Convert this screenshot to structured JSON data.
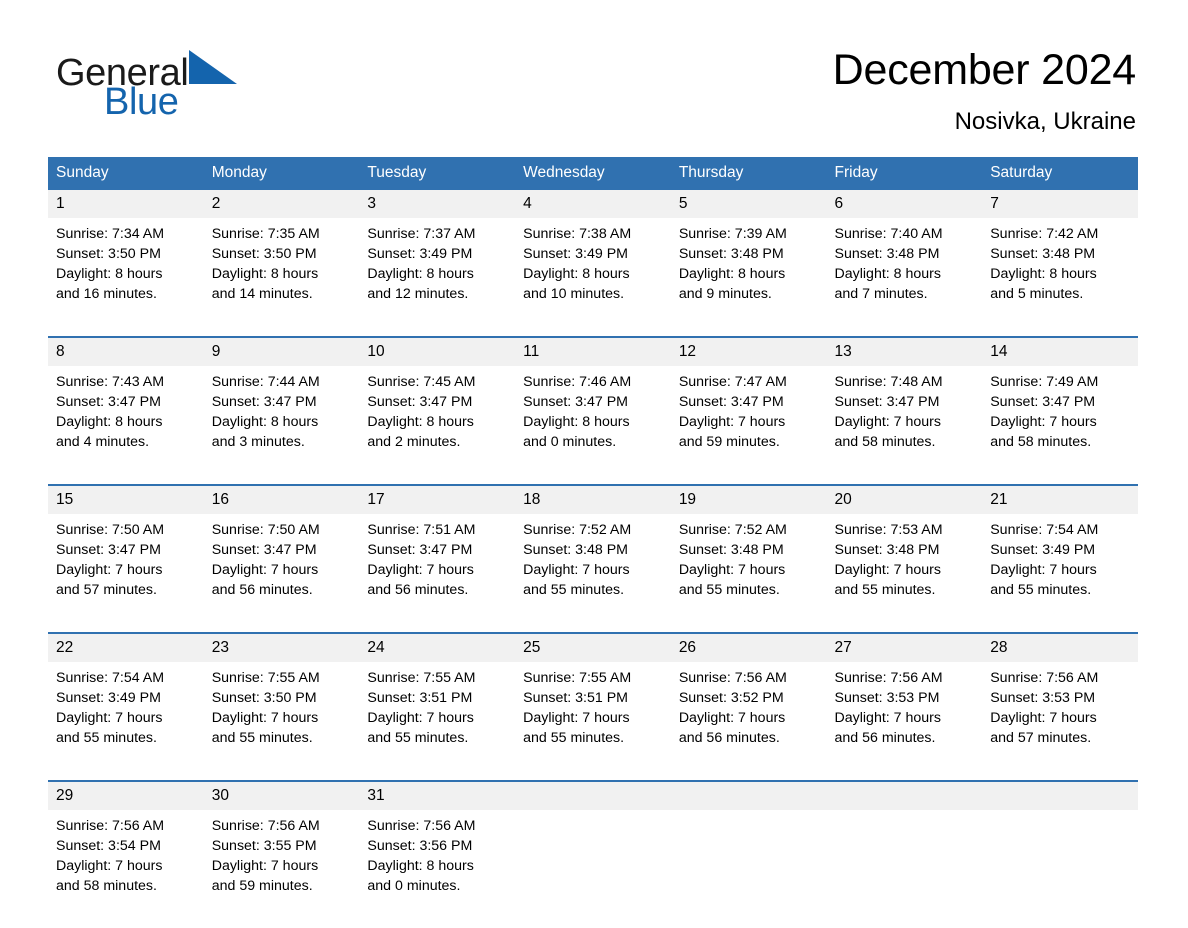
{
  "brand": {
    "name_part1": "General",
    "name_part2": "Blue",
    "triangle_color": "#1464ad",
    "text_color": "#1a1a1a"
  },
  "header": {
    "title": "December 2024",
    "location": "Nosivka, Ukraine"
  },
  "colors": {
    "header_blue": "#3071b0",
    "row_divider_blue": "#3071b0",
    "daynum_band": "#f1f1f1",
    "text": "#000000"
  },
  "weekday_headers": [
    "Sunday",
    "Monday",
    "Tuesday",
    "Wednesday",
    "Thursday",
    "Friday",
    "Saturday"
  ],
  "weeks": [
    {
      "days": [
        {
          "date": "1",
          "sunrise": "Sunrise: 7:34 AM",
          "sunset": "Sunset: 3:50 PM",
          "daylight_1": "Daylight: 8 hours",
          "daylight_2": "and 16 minutes."
        },
        {
          "date": "2",
          "sunrise": "Sunrise: 7:35 AM",
          "sunset": "Sunset: 3:50 PM",
          "daylight_1": "Daylight: 8 hours",
          "daylight_2": "and 14 minutes."
        },
        {
          "date": "3",
          "sunrise": "Sunrise: 7:37 AM",
          "sunset": "Sunset: 3:49 PM",
          "daylight_1": "Daylight: 8 hours",
          "daylight_2": "and 12 minutes."
        },
        {
          "date": "4",
          "sunrise": "Sunrise: 7:38 AM",
          "sunset": "Sunset: 3:49 PM",
          "daylight_1": "Daylight: 8 hours",
          "daylight_2": "and 10 minutes."
        },
        {
          "date": "5",
          "sunrise": "Sunrise: 7:39 AM",
          "sunset": "Sunset: 3:48 PM",
          "daylight_1": "Daylight: 8 hours",
          "daylight_2": "and 9 minutes."
        },
        {
          "date": "6",
          "sunrise": "Sunrise: 7:40 AM",
          "sunset": "Sunset: 3:48 PM",
          "daylight_1": "Daylight: 8 hours",
          "daylight_2": "and 7 minutes."
        },
        {
          "date": "7",
          "sunrise": "Sunrise: 7:42 AM",
          "sunset": "Sunset: 3:48 PM",
          "daylight_1": "Daylight: 8 hours",
          "daylight_2": "and 5 minutes."
        }
      ]
    },
    {
      "days": [
        {
          "date": "8",
          "sunrise": "Sunrise: 7:43 AM",
          "sunset": "Sunset: 3:47 PM",
          "daylight_1": "Daylight: 8 hours",
          "daylight_2": "and 4 minutes."
        },
        {
          "date": "9",
          "sunrise": "Sunrise: 7:44 AM",
          "sunset": "Sunset: 3:47 PM",
          "daylight_1": "Daylight: 8 hours",
          "daylight_2": "and 3 minutes."
        },
        {
          "date": "10",
          "sunrise": "Sunrise: 7:45 AM",
          "sunset": "Sunset: 3:47 PM",
          "daylight_1": "Daylight: 8 hours",
          "daylight_2": "and 2 minutes."
        },
        {
          "date": "11",
          "sunrise": "Sunrise: 7:46 AM",
          "sunset": "Sunset: 3:47 PM",
          "daylight_1": "Daylight: 8 hours",
          "daylight_2": "and 0 minutes."
        },
        {
          "date": "12",
          "sunrise": "Sunrise: 7:47 AM",
          "sunset": "Sunset: 3:47 PM",
          "daylight_1": "Daylight: 7 hours",
          "daylight_2": "and 59 minutes."
        },
        {
          "date": "13",
          "sunrise": "Sunrise: 7:48 AM",
          "sunset": "Sunset: 3:47 PM",
          "daylight_1": "Daylight: 7 hours",
          "daylight_2": "and 58 minutes."
        },
        {
          "date": "14",
          "sunrise": "Sunrise: 7:49 AM",
          "sunset": "Sunset: 3:47 PM",
          "daylight_1": "Daylight: 7 hours",
          "daylight_2": "and 58 minutes."
        }
      ]
    },
    {
      "days": [
        {
          "date": "15",
          "sunrise": "Sunrise: 7:50 AM",
          "sunset": "Sunset: 3:47 PM",
          "daylight_1": "Daylight: 7 hours",
          "daylight_2": "and 57 minutes."
        },
        {
          "date": "16",
          "sunrise": "Sunrise: 7:50 AM",
          "sunset": "Sunset: 3:47 PM",
          "daylight_1": "Daylight: 7 hours",
          "daylight_2": "and 56 minutes."
        },
        {
          "date": "17",
          "sunrise": "Sunrise: 7:51 AM",
          "sunset": "Sunset: 3:47 PM",
          "daylight_1": "Daylight: 7 hours",
          "daylight_2": "and 56 minutes."
        },
        {
          "date": "18",
          "sunrise": "Sunrise: 7:52 AM",
          "sunset": "Sunset: 3:48 PM",
          "daylight_1": "Daylight: 7 hours",
          "daylight_2": "and 55 minutes."
        },
        {
          "date": "19",
          "sunrise": "Sunrise: 7:52 AM",
          "sunset": "Sunset: 3:48 PM",
          "daylight_1": "Daylight: 7 hours",
          "daylight_2": "and 55 minutes."
        },
        {
          "date": "20",
          "sunrise": "Sunrise: 7:53 AM",
          "sunset": "Sunset: 3:48 PM",
          "daylight_1": "Daylight: 7 hours",
          "daylight_2": "and 55 minutes."
        },
        {
          "date": "21",
          "sunrise": "Sunrise: 7:54 AM",
          "sunset": "Sunset: 3:49 PM",
          "daylight_1": "Daylight: 7 hours",
          "daylight_2": "and 55 minutes."
        }
      ]
    },
    {
      "days": [
        {
          "date": "22",
          "sunrise": "Sunrise: 7:54 AM",
          "sunset": "Sunset: 3:49 PM",
          "daylight_1": "Daylight: 7 hours",
          "daylight_2": "and 55 minutes."
        },
        {
          "date": "23",
          "sunrise": "Sunrise: 7:55 AM",
          "sunset": "Sunset: 3:50 PM",
          "daylight_1": "Daylight: 7 hours",
          "daylight_2": "and 55 minutes."
        },
        {
          "date": "24",
          "sunrise": "Sunrise: 7:55 AM",
          "sunset": "Sunset: 3:51 PM",
          "daylight_1": "Daylight: 7 hours",
          "daylight_2": "and 55 minutes."
        },
        {
          "date": "25",
          "sunrise": "Sunrise: 7:55 AM",
          "sunset": "Sunset: 3:51 PM",
          "daylight_1": "Daylight: 7 hours",
          "daylight_2": "and 55 minutes."
        },
        {
          "date": "26",
          "sunrise": "Sunrise: 7:56 AM",
          "sunset": "Sunset: 3:52 PM",
          "daylight_1": "Daylight: 7 hours",
          "daylight_2": "and 56 minutes."
        },
        {
          "date": "27",
          "sunrise": "Sunrise: 7:56 AM",
          "sunset": "Sunset: 3:53 PM",
          "daylight_1": "Daylight: 7 hours",
          "daylight_2": "and 56 minutes."
        },
        {
          "date": "28",
          "sunrise": "Sunrise: 7:56 AM",
          "sunset": "Sunset: 3:53 PM",
          "daylight_1": "Daylight: 7 hours",
          "daylight_2": "and 57 minutes."
        }
      ]
    },
    {
      "days": [
        {
          "date": "29",
          "sunrise": "Sunrise: 7:56 AM",
          "sunset": "Sunset: 3:54 PM",
          "daylight_1": "Daylight: 7 hours",
          "daylight_2": "and 58 minutes."
        },
        {
          "date": "30",
          "sunrise": "Sunrise: 7:56 AM",
          "sunset": "Sunset: 3:55 PM",
          "daylight_1": "Daylight: 7 hours",
          "daylight_2": "and 59 minutes."
        },
        {
          "date": "31",
          "sunrise": "Sunrise: 7:56 AM",
          "sunset": "Sunset: 3:56 PM",
          "daylight_1": "Daylight: 8 hours",
          "daylight_2": "and 0 minutes."
        },
        {
          "date": "",
          "sunrise": "",
          "sunset": "",
          "daylight_1": "",
          "daylight_2": ""
        },
        {
          "date": "",
          "sunrise": "",
          "sunset": "",
          "daylight_1": "",
          "daylight_2": ""
        },
        {
          "date": "",
          "sunrise": "",
          "sunset": "",
          "daylight_1": "",
          "daylight_2": ""
        },
        {
          "date": "",
          "sunrise": "",
          "sunset": "",
          "daylight_1": "",
          "daylight_2": ""
        }
      ]
    }
  ]
}
